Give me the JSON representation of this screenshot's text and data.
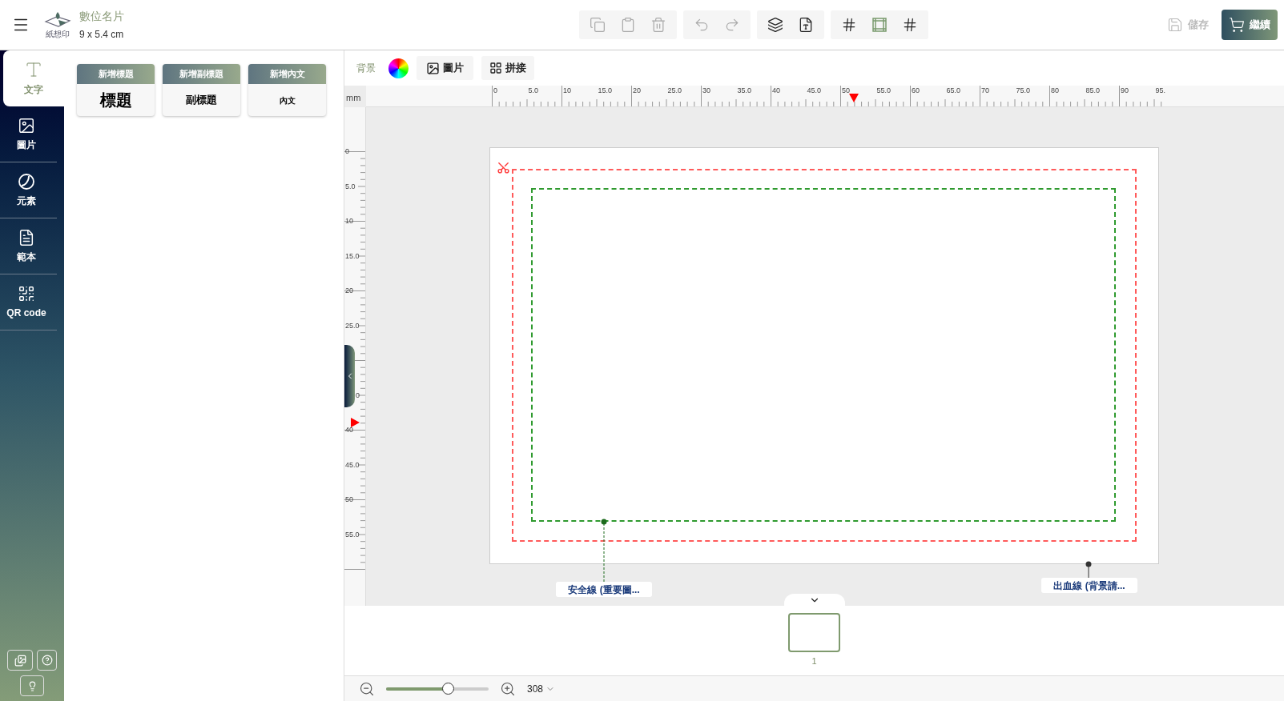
{
  "header": {
    "logo_text": "紙想印",
    "title": "數位名片",
    "size": "9 x 5.4 cm",
    "toolbar": [
      [
        {
          "kind": "copy",
          "disabled": true
        },
        {
          "kind": "paste",
          "disabled": true
        },
        {
          "kind": "delete",
          "disabled": true
        }
      ],
      [
        {
          "kind": "undo",
          "disabled": true
        },
        {
          "kind": "redo",
          "disabled": true
        }
      ],
      [
        {
          "kind": "layers",
          "disabled": false
        },
        {
          "kind": "font",
          "disabled": false
        }
      ],
      [
        {
          "kind": "grid",
          "on": false
        },
        {
          "kind": "frame",
          "on": true
        },
        {
          "kind": "bleed",
          "on": false
        }
      ]
    ],
    "save": {
      "label": "儲存",
      "disabled": true
    },
    "continue": "繼續"
  },
  "nav": [
    {
      "kind": "text",
      "label": "文字",
      "selected": true
    },
    {
      "kind": "image",
      "label": "圖片",
      "selected": false
    },
    {
      "kind": "element",
      "label": "元素",
      "selected": false
    },
    {
      "kind": "template",
      "label": "範本",
      "selected": false
    },
    {
      "kind": "qr",
      "label": "QR code",
      "selected": false
    }
  ],
  "text_presets": [
    {
      "kind": "title",
      "header": "新增標題",
      "sample": "標題"
    },
    {
      "kind": "subtitle",
      "header": "新增副標題",
      "sample": "副標題"
    },
    {
      "kind": "body",
      "header": "新增內文",
      "sample": "內文"
    }
  ],
  "canvas_toolbar": {
    "background_label": "背景",
    "image_button": "圖片",
    "tile_button": "拼接"
  },
  "ruler": {
    "unit": "mm",
    "x_labels": [
      "0",
      "5.0",
      "10",
      "15.0",
      "20",
      "25.0",
      "30",
      "35.0",
      "40",
      "45.0",
      "50",
      "55.0",
      "60",
      "65.0",
      "70",
      "75.0",
      "80",
      "85.0",
      "90",
      "95."
    ],
    "y_labels": [
      "0",
      "5.0",
      "10",
      "15.0",
      "20",
      "25.0",
      "0",
      "40",
      "45.0",
      "50",
      "55.0"
    ]
  },
  "guides": {
    "safe_label": "安全線 (重要圖...",
    "bleed_label": "出血線 (背景請..."
  },
  "pages": [
    {
      "number": "1",
      "selected": true
    }
  ],
  "zoom": {
    "level": 0.6,
    "value": "308"
  }
}
